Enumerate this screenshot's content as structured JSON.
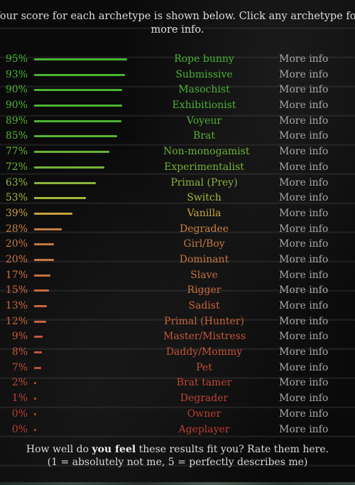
{
  "intro_text": "Your score for each archetype is shown below. Click any archetype for more info.",
  "more_info_label": "More info",
  "footer": {
    "line1_prefix": "How well do ",
    "line1_bold": "you feel",
    "line1_suffix": " these results fit you? Rate them here.",
    "line2": "(1 = absolutely not me, 5 = perfectly describes me)"
  },
  "chart_data": {
    "type": "bar",
    "orientation": "horizontal",
    "title": "",
    "xlabel": "",
    "ylabel": "",
    "xlim": [
      0,
      100
    ],
    "unit": "%",
    "categories": [
      "Rope bunny",
      "Submissive",
      "Masochist",
      "Exhibitionist",
      "Voyeur",
      "Brat",
      "Non-monogamist",
      "Experimentalist",
      "Primal (Prey)",
      "Switch",
      "Vanilla",
      "Degradee",
      "Girl/Boy",
      "Dominant",
      "Slave",
      "Rigger",
      "Sadist",
      "Primal (Hunter)",
      "Master/Mistress",
      "Daddy/Mommy",
      "Pet",
      "Brat tamer",
      "Degrader",
      "Owner",
      "Ageplayer"
    ],
    "values": [
      95,
      93,
      90,
      90,
      89,
      85,
      77,
      72,
      63,
      53,
      39,
      28,
      20,
      20,
      17,
      15,
      13,
      12,
      9,
      8,
      7,
      2,
      1,
      0,
      0
    ],
    "colors": [
      "#46b52f",
      "#48b530",
      "#4db332",
      "#4db332",
      "#4eb332",
      "#55b233",
      "#69b334",
      "#74b335",
      "#8cb33a",
      "#a6b83a",
      "#c7a23c",
      "#c9803e",
      "#c87740",
      "#c87740",
      "#c9703f",
      "#c86b3e",
      "#c8663e",
      "#c7633d",
      "#c5573b",
      "#c4533a",
      "#c24f38",
      "#c04535",
      "#bf4234",
      "#bd3e33",
      "#bd3e33"
    ]
  }
}
